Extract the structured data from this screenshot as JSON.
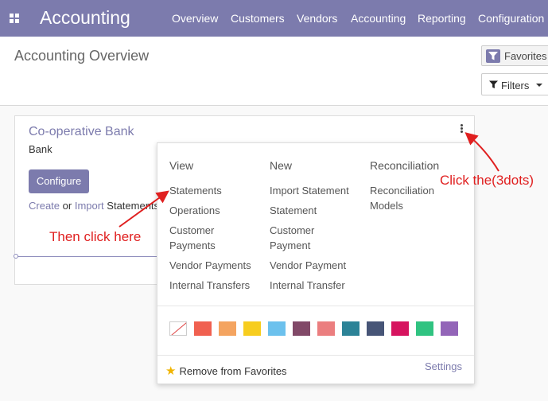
{
  "app": {
    "brand": "Accounting"
  },
  "nav": {
    "items": [
      {
        "label": "Overview"
      },
      {
        "label": "Customers"
      },
      {
        "label": "Vendors"
      },
      {
        "label": "Accounting"
      },
      {
        "label": "Reporting"
      },
      {
        "label": "Configuration"
      }
    ]
  },
  "control_panel": {
    "title": "Accounting Overview",
    "favorites_label": "Favorites",
    "filters_label": "Filters"
  },
  "journal": {
    "title": "Co-operative Bank",
    "subtitle": "Bank",
    "configure_label": "Configure",
    "create_link": "Create",
    "or_text": " or ",
    "import_link": "Import",
    "statements_text": " Statements"
  },
  "dropdown": {
    "view": {
      "heading": "View",
      "items": [
        "Statements",
        "Operations",
        "Customer Payments",
        "Vendor Payments",
        "Internal Transfers"
      ]
    },
    "new": {
      "heading": "New",
      "items": [
        "Import Statement",
        "Statement",
        "Customer Payment",
        "Vendor Payment",
        "Internal Transfer"
      ]
    },
    "reconciliation": {
      "heading": "Reconciliation",
      "items": [
        "Reconciliation Models"
      ]
    },
    "colors": [
      "none",
      "#f06050",
      "#f4a460",
      "#f7cd1f",
      "#6cc1ed",
      "#814968",
      "#eb7e7f",
      "#2c8397",
      "#475577",
      "#d6145f",
      "#30c381",
      "#9365b8"
    ],
    "remove_favorites": "Remove from Favorites",
    "settings": "Settings"
  },
  "annotations": {
    "click_dots": "Click the(3dots)",
    "then_click": "Then click here",
    "color": "#e02020"
  }
}
